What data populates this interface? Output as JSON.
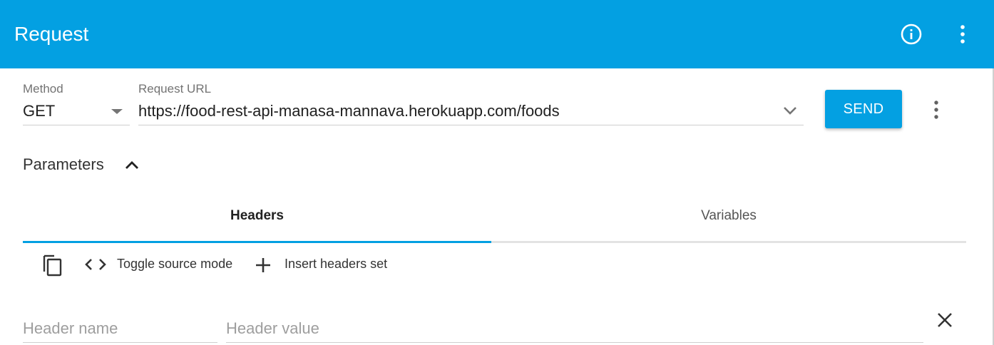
{
  "appbar": {
    "title": "Request",
    "info_icon": "info-circle-icon",
    "more_icon": "more-vertical-icon"
  },
  "request": {
    "method_label": "Method",
    "method_value": "GET",
    "url_label": "Request URL",
    "url_value": "https://food-rest-api-manasa-mannava.herokuapp.com/foods",
    "send_label": "SEND"
  },
  "parameters": {
    "title": "Parameters",
    "tabs": [
      {
        "label": "Headers",
        "active": true
      },
      {
        "label": "Variables",
        "active": false
      }
    ]
  },
  "toolbar": {
    "toggle_source_label": "Toggle source mode",
    "insert_headers_label": "Insert headers set"
  },
  "header_row": {
    "name_placeholder": "Header name",
    "value_placeholder": "Header value"
  },
  "colors": {
    "accent": "#03a0e2",
    "text_primary": "#212121",
    "text_muted": "#737373",
    "placeholder": "#9e9e9e"
  }
}
